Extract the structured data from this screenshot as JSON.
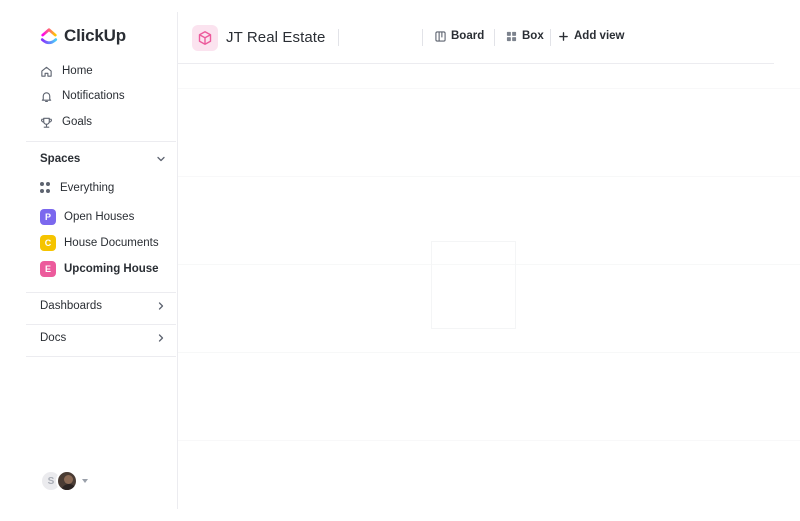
{
  "app": {
    "name": "ClickUp"
  },
  "sidebar": {
    "nav": [
      {
        "label": "Home",
        "icon": "home-icon"
      },
      {
        "label": "Notifications",
        "icon": "bell-icon"
      },
      {
        "label": "Goals",
        "icon": "trophy-icon"
      }
    ],
    "spaces_title": "Spaces",
    "spaces": [
      {
        "label": "Everything",
        "icon": "grid-dots-icon"
      },
      {
        "label": "Open Houses",
        "badge": "P",
        "color": "#7b68ee"
      },
      {
        "label": "House Documents",
        "badge": "C",
        "color": "#f5c400"
      },
      {
        "label": "Upcoming House",
        "badge": "E",
        "color": "#ec5b9c",
        "active": true
      }
    ],
    "dashboards": "Dashboards",
    "docs": "Docs",
    "user_initial": "S"
  },
  "header": {
    "workspace": "JT Real Estate",
    "views": [
      {
        "label": "Board",
        "icon": "board-icon"
      },
      {
        "label": "Box",
        "icon": "box-grid-icon"
      }
    ],
    "add_view": "Add view"
  },
  "colors": {
    "accent_pink": "#ec5b9c",
    "text": "#2a2e34",
    "border": "#ececf0"
  }
}
